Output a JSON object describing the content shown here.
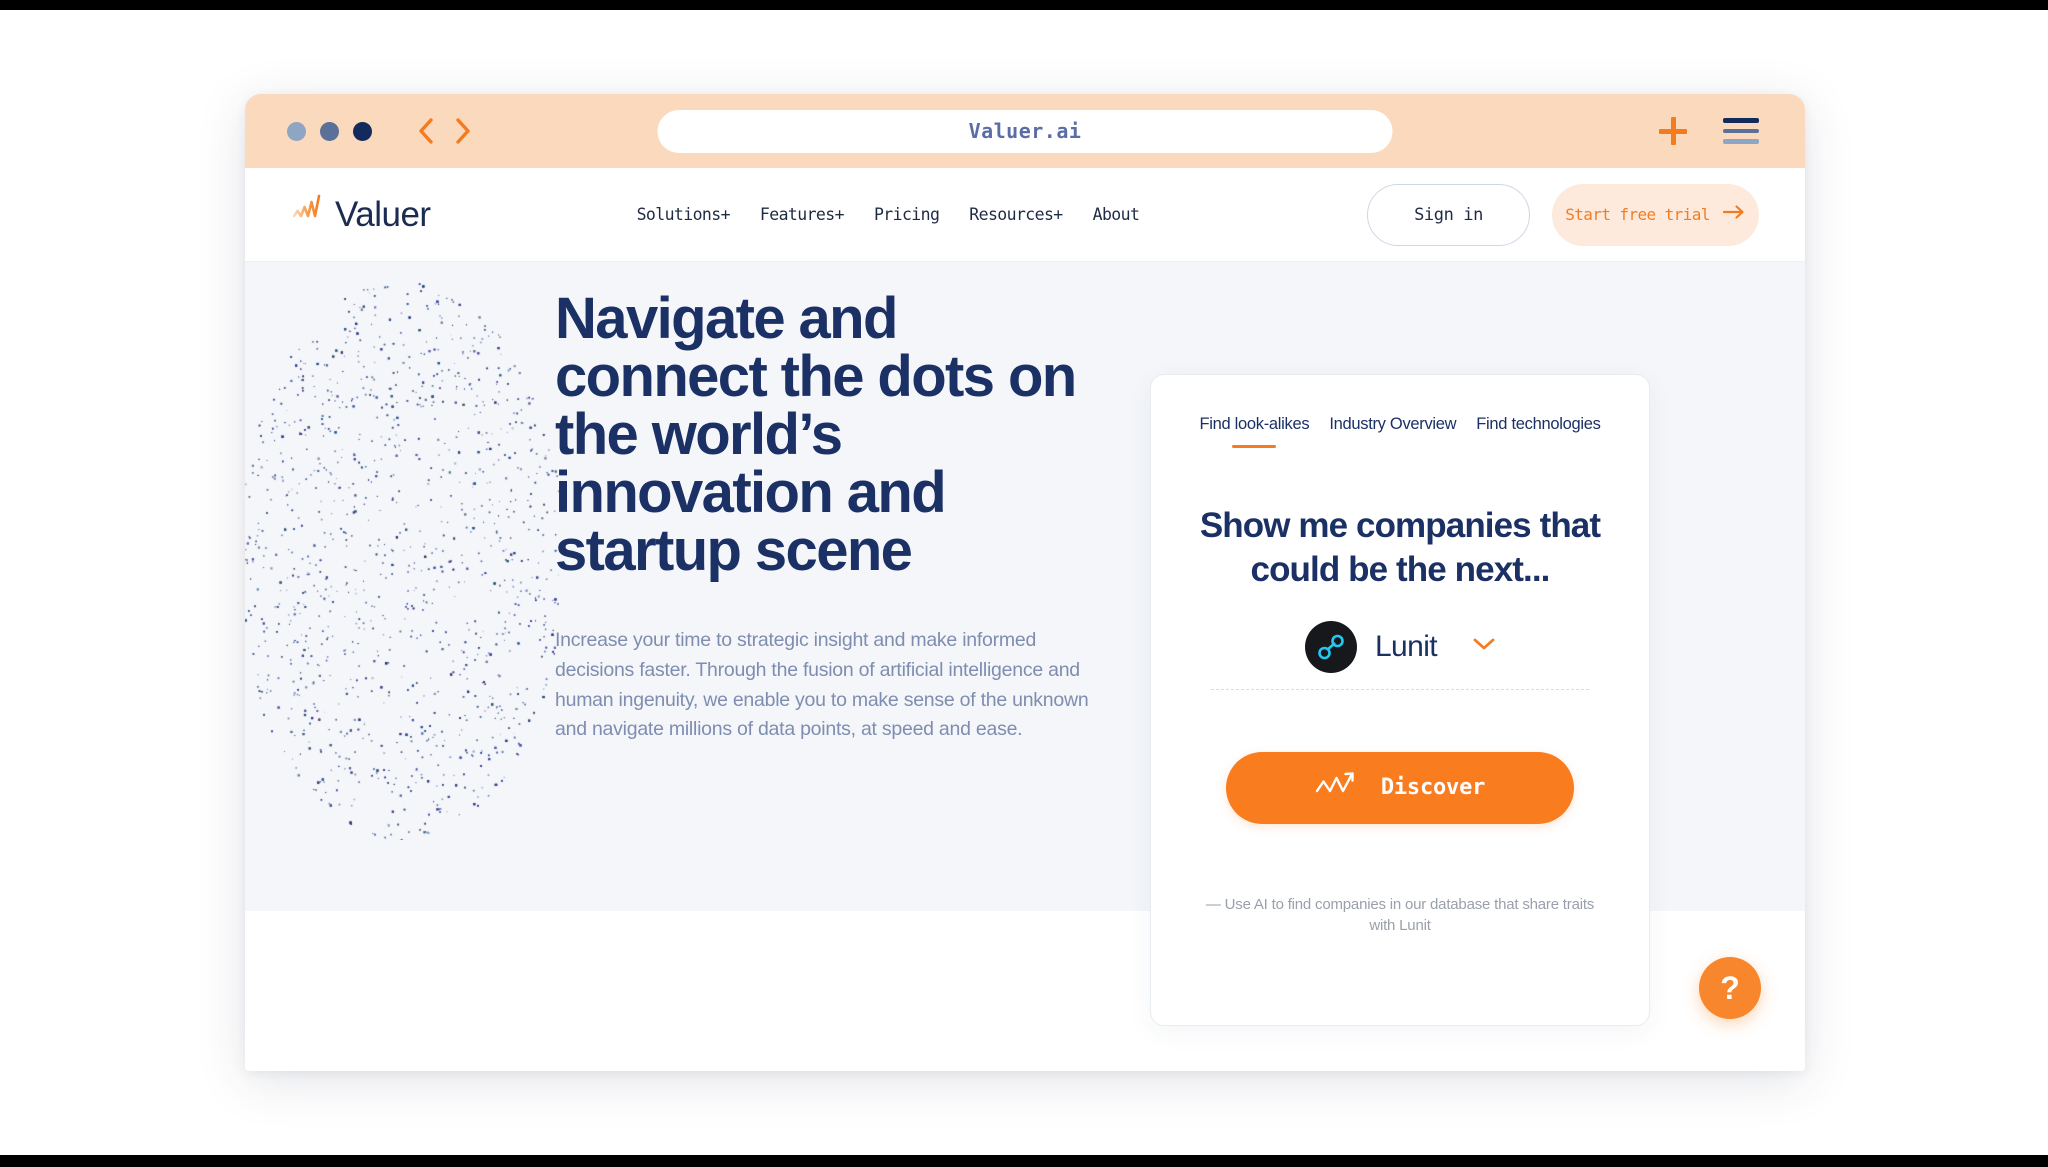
{
  "browser": {
    "url": "Valuer.ai",
    "window_dots": [
      "window-dot-1",
      "window-dot-2",
      "window-dot-3"
    ],
    "back_icon": "chevron-left-icon",
    "forward_icon": "chevron-right-icon",
    "new_tab_icon": "plus-icon",
    "menu_icon": "hamburger-menu-icon"
  },
  "nav": {
    "logo_text": "Valuer",
    "logo_mark": "wave-logo-icon",
    "menu": [
      {
        "label": "Solutions+"
      },
      {
        "label": "Features+"
      },
      {
        "label": "Pricing"
      },
      {
        "label": "Resources+"
      },
      {
        "label": "About"
      }
    ],
    "signin_label": "Sign in",
    "trial_label": "Start free trial",
    "trial_arrow_icon": "arrow-right-icon"
  },
  "hero": {
    "title": "Navigate and connect the dots on the world’s innovation and startup scene",
    "subtitle": "Increase your time to strategic insight and make informed decisions faster. Through the fusion of artificial intelligence and human ingenuity, we enable you to make sense of the unknown and navigate millions of data points, at speed and ease.",
    "decoration": "particle-dot-cloud"
  },
  "card": {
    "tabs": [
      {
        "label": "Find look-alikes",
        "active": true
      },
      {
        "label": "Industry Overview",
        "active": false
      },
      {
        "label": "Find technologies",
        "active": false
      }
    ],
    "heading": "Show me companies that could be the next...",
    "company": {
      "name": "Lunit",
      "logo_icon": "lunit-node-link-logo-icon",
      "chevron_icon": "chevron-down-icon"
    },
    "discover_label": "Discover",
    "discover_icon": "trending-up-zigzag-icon",
    "footnote": "— Use AI to find companies in our database that share traits with Lunit"
  },
  "help": {
    "label": "?",
    "icon": "question-mark-icon"
  },
  "colors": {
    "accent_orange": "#f47c20",
    "discover_orange": "#f97c1e",
    "chrome_peach": "#fbd9bd",
    "trial_peach": "#fdeadc",
    "navy": "#1b3064",
    "navy_dark": "#122a5c",
    "muted_blue": "#7e8db0",
    "hero_bg": "#f4f6f9",
    "lunit_cyan": "#22c8f0",
    "lunit_dark": "#17181c"
  }
}
